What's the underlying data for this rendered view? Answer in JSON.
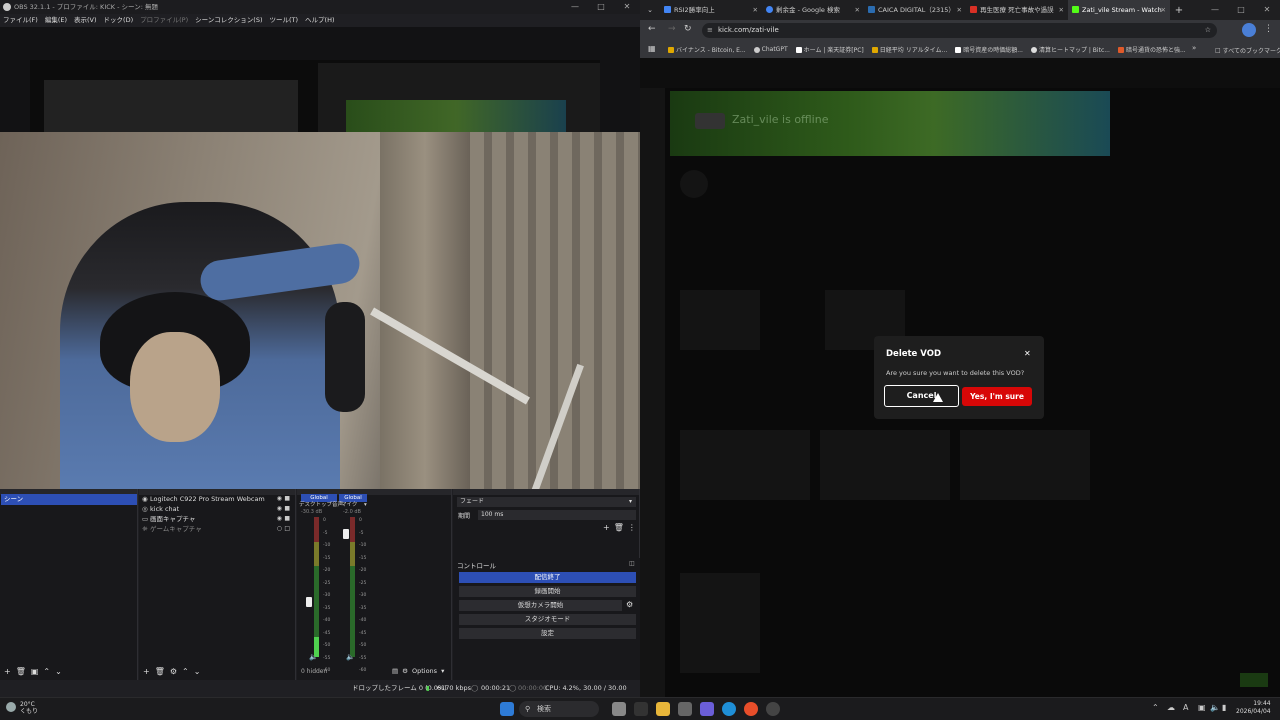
{
  "obs": {
    "title": "OBS 32.1.1 - プロファイル: KICK - シーン: 無題",
    "menu": [
      "ファイル(F)",
      "編集(E)",
      "表示(V)",
      "ドック(D)",
      "プロファイル(P)",
      "シーンコレクション(S)",
      "ツール(T)",
      "ヘルプ(H)"
    ],
    "scenes": {
      "selected": "シーン"
    },
    "sources": [
      {
        "icon": "webcam",
        "label": "Logitech C922 Pro Stream Webcam"
      },
      {
        "icon": "browser",
        "label": "kick chat"
      },
      {
        "icon": "display",
        "label": "画面キャプチャ"
      },
      {
        "icon": "gamepad",
        "label": "ゲームキャプチャ"
      }
    ],
    "mixer": {
      "channels": [
        {
          "hdr": "Global",
          "name": "デスクトップ音声",
          "db": "-30.3 dB",
          "level": 0.14
        },
        {
          "hdr": "Global",
          "name": "マイク",
          "db": "-2.0 dB",
          "level": 0
        }
      ],
      "scale": [
        "0",
        "-5",
        "-10",
        "-15",
        "-20",
        "-25",
        "-30",
        "-35",
        "-40",
        "-45",
        "-50",
        "-55",
        "-60"
      ],
      "hidden": "0 hidden",
      "options": "Options"
    },
    "transition": {
      "type": "フェード",
      "duration_label": "期間",
      "duration": "100 ms"
    },
    "controls": {
      "title": "コントロール",
      "buttons": [
        "配信終了",
        "録画開始",
        "仮想カメラ開始",
        "スタジオモード",
        "設定"
      ]
    },
    "status": {
      "dropped": "ドロップしたフレーム 0 (0.0%)",
      "kbps": "6170 kbps",
      "stream_time": "00:00:21",
      "rec_time": "00:00:00",
      "cpu": "CPU: 4.2%, 30.00 / 30.00 FPS"
    }
  },
  "browser": {
    "tabs": [
      {
        "label": "RSI2勝率向上",
        "color": "#4285f4"
      },
      {
        "label": "剰余金 - Google 検索",
        "color": "#4285f4"
      },
      {
        "label": "CAICA DIGITAL（2315）",
        "color": "#2b6cb0"
      },
      {
        "label": "再生医療 死亡事故や過誤",
        "color": "#d93025"
      },
      {
        "label": "Zati_vile Stream - Watch",
        "color": "#53fc18"
      }
    ],
    "url": "kick.com/zati-vile",
    "bookmarks": [
      "バイナンス - Bitcoin, E...",
      "ChatGPT",
      "ホーム | 楽天証券[PC]",
      "日経平均 リアルタイム...",
      "暗号資産の時価総額...",
      "清算ヒートマップ | Bitc...",
      "暗号通貨の恐怖と強..."
    ],
    "all_bookmarks": "すべてのブックマーク",
    "page": {
      "banner_text": "Zati_vile is offline"
    },
    "modal": {
      "title": "Delete VOD",
      "message": "Are you sure you want to delete this VOD?",
      "cancel": "Cancel",
      "confirm": "Yes, I'm sure",
      "confirm_color": "#d70707"
    }
  },
  "taskbar": {
    "weather_temp": "20°C",
    "weather_desc": "くもり",
    "search": "検索",
    "time": "19:44",
    "date": "2026/04/04"
  }
}
